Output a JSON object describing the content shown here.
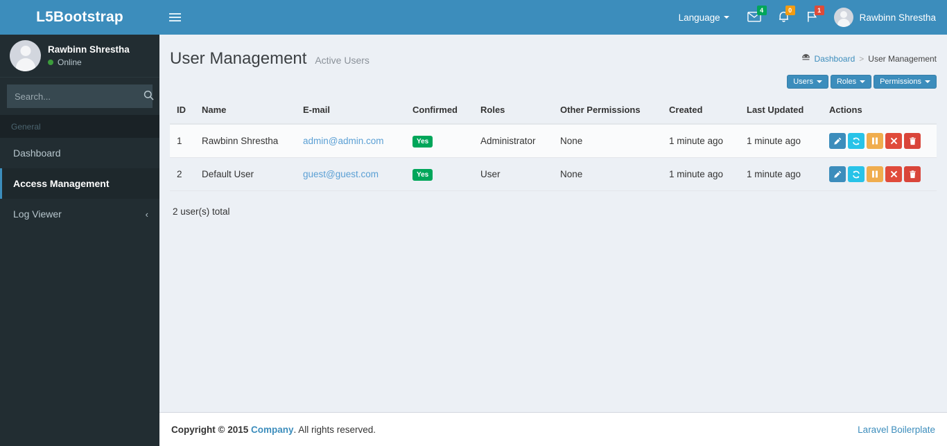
{
  "brand": {
    "logo_text": "L5Bootstrap",
    "accent": "#3c8dbc"
  },
  "sidebar": {
    "user": {
      "name": "Rawbinn Shrestha",
      "status": "Online",
      "status_color": "#3c9c3c"
    },
    "search": {
      "placeholder": "Search...",
      "value": "",
      "icon": "search-icon"
    },
    "menu_header": "General",
    "items": [
      {
        "label": "Dashboard",
        "active": false
      },
      {
        "label": "Access Management",
        "active": true
      },
      {
        "label": "Log Viewer",
        "active": false,
        "chevron": "chevron-left-icon"
      }
    ]
  },
  "header": {
    "toggle_icon": "hamburger-icon",
    "language": {
      "label": "Language",
      "caret": "caret-down-icon"
    },
    "icons": [
      {
        "name": "envelope-icon",
        "badge": "4",
        "badge_color": "#00a65a"
      },
      {
        "name": "bell-icon",
        "badge": "0",
        "badge_color": "#f39c12"
      },
      {
        "name": "flag-icon",
        "badge": "1",
        "badge_color": "#dd4b39"
      }
    ],
    "user_name": "Rawbinn Shrestha"
  },
  "content": {
    "title": "User Management",
    "subtitle": "Active Users",
    "breadcrumb": {
      "home_icon": "dashboard-icon",
      "home": "Dashboard",
      "separator": ">",
      "current": "User Management"
    },
    "buttons": [
      {
        "label": "Users",
        "caret": "caret-down-icon"
      },
      {
        "label": "Roles",
        "caret": "caret-down-icon"
      },
      {
        "label": "Permissions",
        "caret": "caret-down-icon"
      }
    ],
    "table": {
      "columns": [
        "ID",
        "Name",
        "E-mail",
        "Confirmed",
        "Roles",
        "Other Permissions",
        "Created",
        "Last Updated",
        "Actions"
      ],
      "rows": [
        {
          "id": "1",
          "name": "Rawbinn Shrestha",
          "email": "admin@admin.com",
          "confirmed": "Yes",
          "roles": "Administrator",
          "other_permissions": "None",
          "created": "1 minute ago",
          "last_updated": "1 minute ago"
        },
        {
          "id": "2",
          "name": "Default User",
          "email": "guest@guest.com",
          "confirmed": "Yes",
          "roles": "User",
          "other_permissions": "None",
          "created": "1 minute ago",
          "last_updated": "1 minute ago"
        }
      ],
      "action_icons": [
        "edit-icon",
        "restore-icon",
        "pause-icon",
        "deactivate-icon",
        "delete-icon"
      ],
      "total_text": "2 user(s) total"
    }
  },
  "footer": {
    "copyright_prefix": "Copyright © 2015 ",
    "company": "Company",
    "copyright_suffix": ". All rights reserved.",
    "right_link": "Laravel Boilerplate"
  }
}
